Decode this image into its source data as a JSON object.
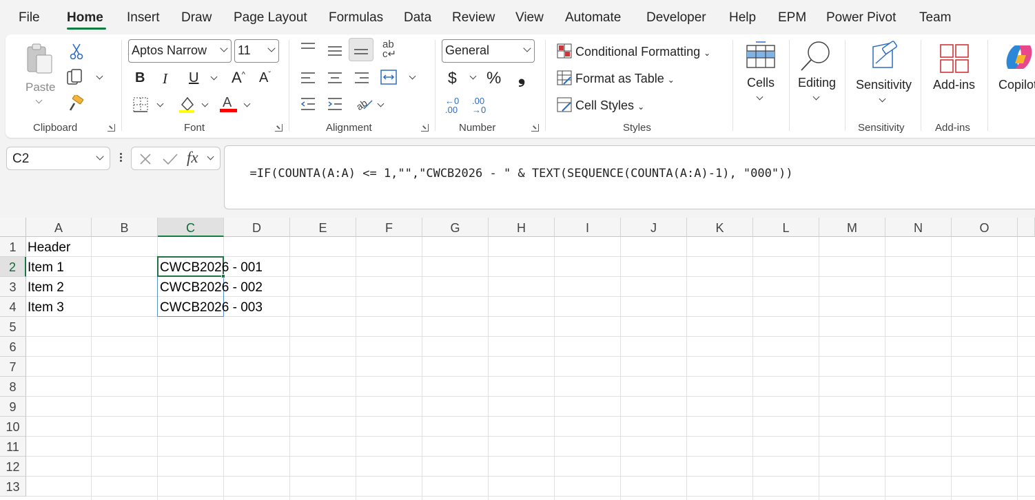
{
  "menu": {
    "tabs": [
      "File",
      "Home",
      "Insert",
      "Draw",
      "Page Layout",
      "Formulas",
      "Data",
      "Review",
      "View",
      "Automate",
      "Developer",
      "Help",
      "EPM",
      "Power Pivot",
      "Team"
    ],
    "active": "Home"
  },
  "ribbon": {
    "clipboard": {
      "paste_label": "Paste",
      "group_label": "Clipboard"
    },
    "font": {
      "font_name": "Aptos Narrow",
      "font_size": "11",
      "bold": "B",
      "italic": "I",
      "underline": "U",
      "group_label": "Font"
    },
    "alignment": {
      "group_label": "Alignment"
    },
    "number": {
      "format": "General",
      "currency": "$",
      "percent": "%",
      "comma": "❟",
      "inc_decimal": "←0\n.00",
      "dec_decimal": ".00\n→0",
      "group_label": "Number"
    },
    "styles": {
      "conditional_formatting": "Conditional Formatting",
      "format_as_table": "Format as Table",
      "cell_styles": "Cell Styles",
      "group_label": "Styles"
    },
    "cells": {
      "label": "Cells"
    },
    "editing": {
      "label": "Editing"
    },
    "sensitivity": {
      "label": "Sensitivity",
      "group_label": "Sensitivity"
    },
    "addins": {
      "label": "Add-ins",
      "group_label": "Add-ins"
    },
    "copilot": {
      "label": "Copilot"
    }
  },
  "formula_bar": {
    "name_box": "C2",
    "formula": "=IF(COUNTA(A:A) <= 1,\"\",\"CWCB2026 - \" & TEXT(SEQUENCE(COUNTA(A:A)-1), \"000\"))"
  },
  "sheet": {
    "columns": [
      "A",
      "B",
      "C",
      "D",
      "E",
      "F",
      "G",
      "H",
      "I",
      "J",
      "K",
      "L",
      "M",
      "N",
      "O"
    ],
    "rows": [
      "1",
      "2",
      "3",
      "4",
      "5",
      "6",
      "7",
      "8",
      "9",
      "10",
      "11",
      "12",
      "13"
    ],
    "selected_column": "C",
    "selected_row": "2",
    "cells": {
      "A1": "Header",
      "A2": "Item 1",
      "A3": "Item 2",
      "A4": "Item 3",
      "C2": "CWCB2026 - 001",
      "C3": "CWCB2026 - 002",
      "C4": "CWCB2026 - 003"
    }
  },
  "colors": {
    "accent": "#107c41",
    "selection_border": "#217346"
  }
}
